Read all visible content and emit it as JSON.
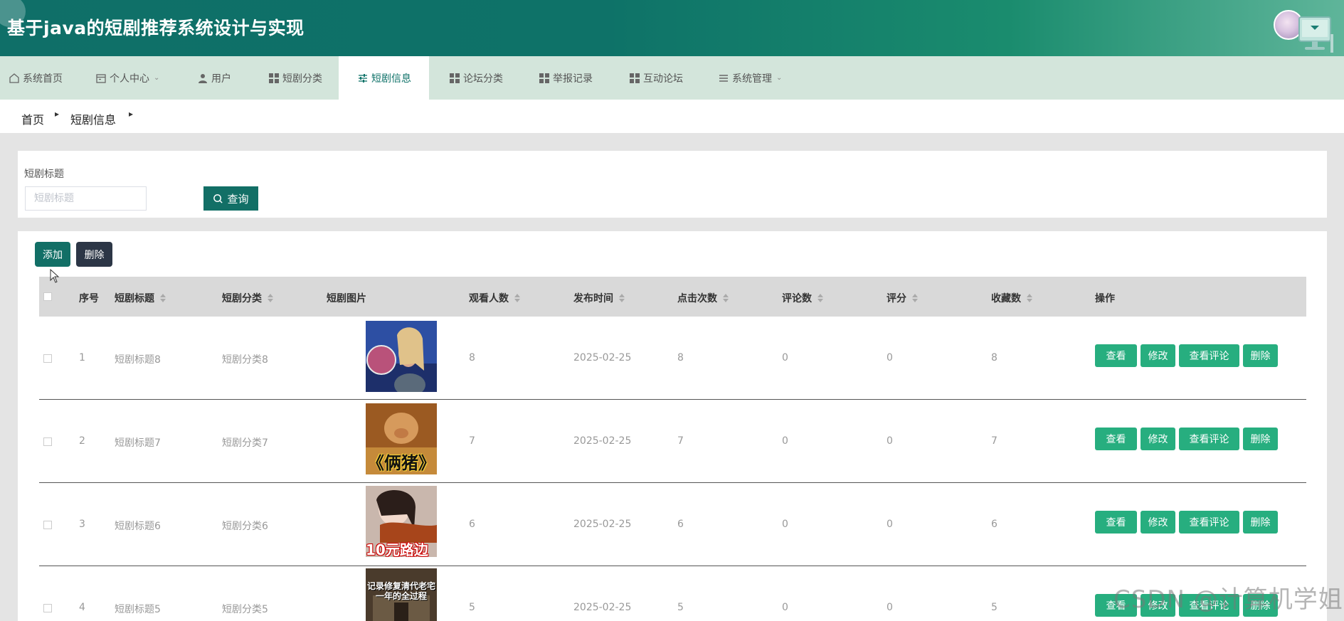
{
  "app": {
    "title": "基于java的短剧推荐系统设计与实现"
  },
  "nav": {
    "items": [
      {
        "label": "系统首页",
        "icon": "home-icon"
      },
      {
        "label": "个人中心",
        "icon": "calendar-icon",
        "dropdown": true
      },
      {
        "label": "用户",
        "icon": "user-icon"
      },
      {
        "label": "短剧分类",
        "icon": "grid-icon"
      },
      {
        "label": "短剧信息",
        "icon": "sliders-icon",
        "active": true
      },
      {
        "label": "论坛分类",
        "icon": "grid-icon"
      },
      {
        "label": "举报记录",
        "icon": "grid-icon"
      },
      {
        "label": "互动论坛",
        "icon": "grid-icon"
      },
      {
        "label": "系统管理",
        "icon": "list-icon",
        "dropdown": true
      }
    ]
  },
  "breadcrumb": {
    "home": "首页",
    "current": "短剧信息"
  },
  "search": {
    "label": "短剧标题",
    "placeholder": "短剧标题",
    "value": "",
    "button": "查询"
  },
  "toolbar": {
    "add": "添加",
    "delete": "删除"
  },
  "table": {
    "headers": [
      "序号",
      "短剧标题",
      "短剧分类",
      "短剧图片",
      "观看人数",
      "发布时间",
      "点击次数",
      "评论数",
      "评分",
      "收藏数",
      "操作"
    ],
    "rows": [
      {
        "no": "1",
        "title": "短剧标题8",
        "category": "短剧分类8",
        "image_caption": "",
        "views": "8",
        "date": "2025-02-25",
        "clicks": "8",
        "comments": "0",
        "score": "0",
        "favorites": "8"
      },
      {
        "no": "2",
        "title": "短剧标题7",
        "category": "短剧分类7",
        "image_caption": "《俩猪》",
        "views": "7",
        "date": "2025-02-25",
        "clicks": "7",
        "comments": "0",
        "score": "0",
        "favorites": "7"
      },
      {
        "no": "3",
        "title": "短剧标题6",
        "category": "短剧分类6",
        "image_caption": "10元路边",
        "views": "6",
        "date": "2025-02-25",
        "clicks": "6",
        "comments": "0",
        "score": "0",
        "favorites": "6"
      },
      {
        "no": "4",
        "title": "短剧标题5",
        "category": "短剧分类5",
        "image_caption": "记录修复清代老宅 一年的全过程",
        "views": "5",
        "date": "2025-02-25",
        "clicks": "5",
        "comments": "0",
        "score": "0",
        "favorites": "5"
      }
    ],
    "actions": {
      "view": "查看",
      "edit": "修改",
      "comments": "查看评论",
      "delete": "删除"
    }
  },
  "watermark": "CSDN @计算机学姐",
  "colors": {
    "primary": "#126f66",
    "nav_bg": "#d3e5db",
    "action_green": "#27ae7f",
    "dark_button": "#2c3646"
  }
}
